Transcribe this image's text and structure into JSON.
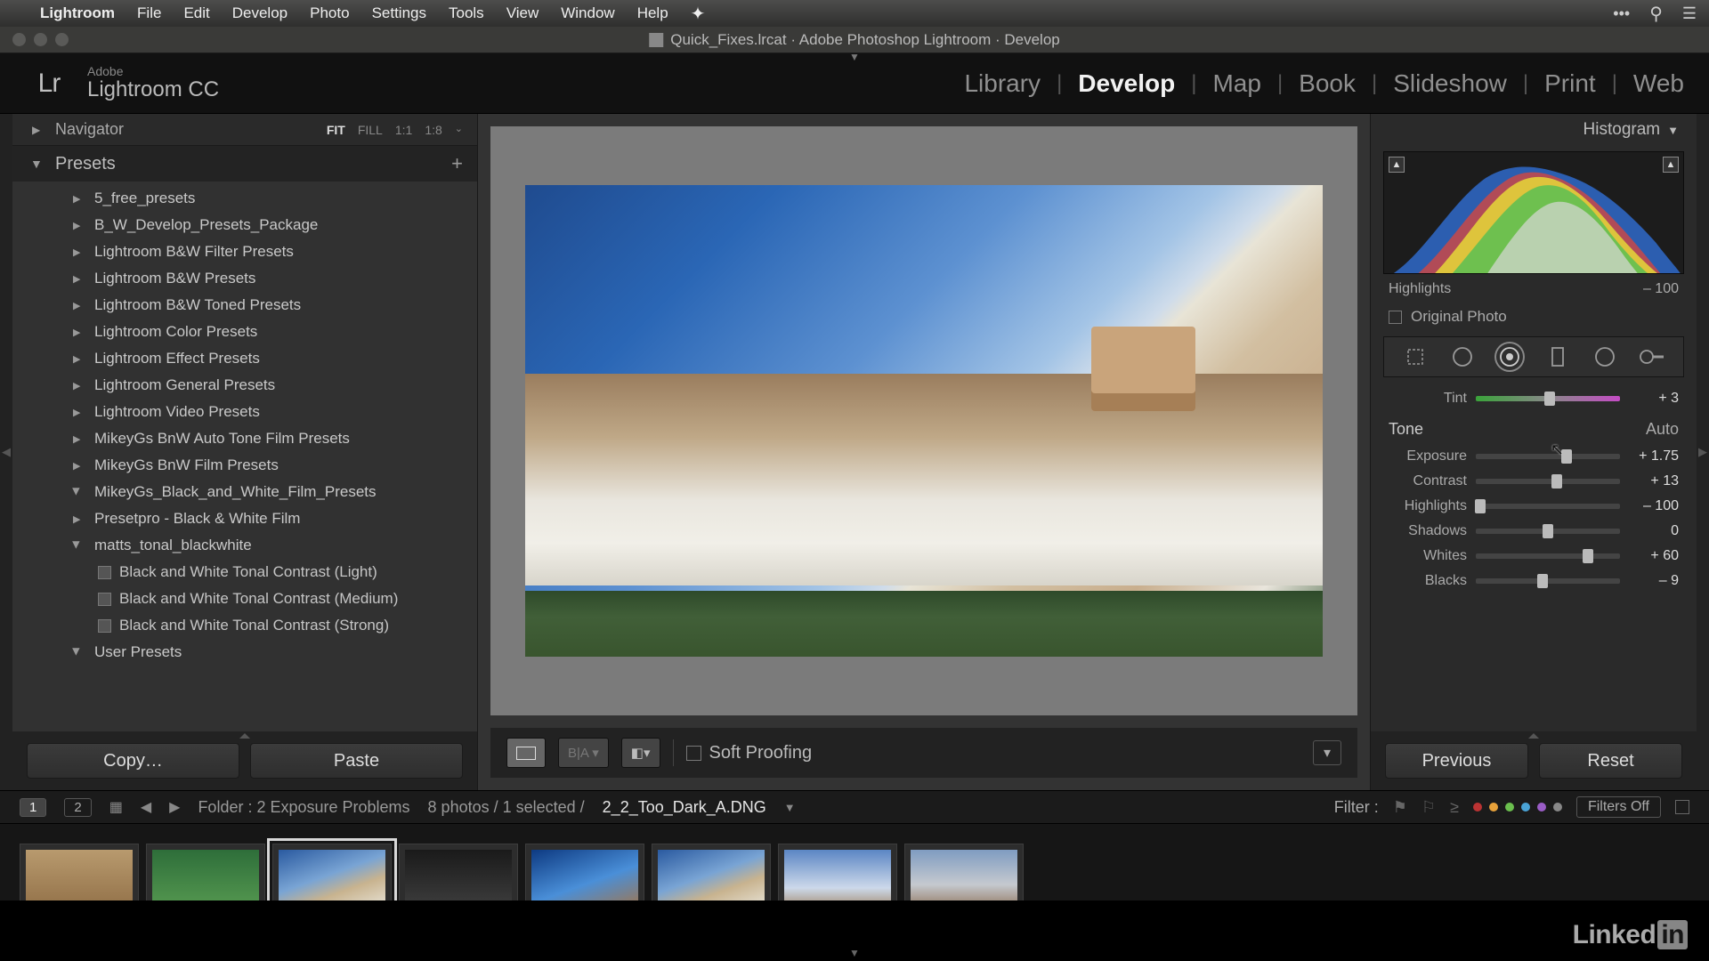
{
  "menubar": {
    "app": "Lightroom",
    "items": [
      "File",
      "Edit",
      "Develop",
      "Photo",
      "Settings",
      "Tools",
      "View",
      "Window",
      "Help"
    ]
  },
  "window": {
    "title": "Quick_Fixes.lrcat · Adobe Photoshop Lightroom · Develop"
  },
  "identity": {
    "brand_small": "Adobe",
    "brand_large": "Lightroom CC",
    "logo": "Lr"
  },
  "modules": [
    "Library",
    "Develop",
    "Map",
    "Book",
    "Slideshow",
    "Print",
    "Web"
  ],
  "modules_active": "Develop",
  "nav": {
    "title": "Navigator",
    "opts": [
      "FIT",
      "FILL",
      "1:1",
      "1:8"
    ],
    "active": "FIT"
  },
  "presets": {
    "title": "Presets",
    "folders": [
      {
        "name": "5_free_presets",
        "open": false
      },
      {
        "name": "B_W_Develop_Presets_Package",
        "open": false
      },
      {
        "name": "Lightroom B&W Filter Presets",
        "open": false
      },
      {
        "name": "Lightroom B&W Presets",
        "open": false
      },
      {
        "name": "Lightroom B&W Toned Presets",
        "open": false
      },
      {
        "name": "Lightroom Color Presets",
        "open": false
      },
      {
        "name": "Lightroom Effect Presets",
        "open": false
      },
      {
        "name": "Lightroom General Presets",
        "open": false
      },
      {
        "name": "Lightroom Video Presets",
        "open": false
      },
      {
        "name": "MikeyGs BnW Auto Tone Film Presets",
        "open": false
      },
      {
        "name": "MikeyGs BnW Film Presets",
        "open": false
      },
      {
        "name": "MikeyGs_Black_and_White_Film_Presets",
        "open": true,
        "items": []
      },
      {
        "name": "Presetpro - Black & White Film",
        "open": false
      },
      {
        "name": "matts_tonal_blackwhite",
        "open": true,
        "items": [
          "Black and White Tonal Contrast (Light)",
          "Black and White Tonal Contrast (Medium)",
          "Black and White Tonal Contrast (Strong)"
        ]
      },
      {
        "name": "User Presets",
        "open": true,
        "items": []
      }
    ]
  },
  "buttons": {
    "copy": "Copy…",
    "paste": "Paste",
    "prev": "Previous",
    "reset": "Reset"
  },
  "toolbar": {
    "soft": "Soft Proofing"
  },
  "hist": {
    "title": "Histogram",
    "readout_label": "Highlights",
    "readout_val": "– 100",
    "orig": "Original Photo"
  },
  "wb": {
    "tint_label": "Tint",
    "tint_val": "+ 3"
  },
  "tone": {
    "title": "Tone",
    "auto": "Auto",
    "rows": [
      {
        "label": "Exposure",
        "val": "+ 1.75",
        "pos": 63
      },
      {
        "label": "Contrast",
        "val": "+ 13",
        "pos": 56
      },
      {
        "label": "Highlights",
        "val": "– 100",
        "pos": 3
      },
      {
        "label": "Shadows",
        "val": "0",
        "pos": 50
      },
      {
        "label": "Whites",
        "val": "+ 60",
        "pos": 78
      },
      {
        "label": "Blacks",
        "val": "– 9",
        "pos": 46
      }
    ]
  },
  "status": {
    "folder": "Folder : 2 Exposure Problems",
    "count": "8 photos / 1 selected /",
    "file": "2_2_Too_Dark_A.DNG",
    "filter": "Filter :",
    "filters_off": "Filters Off"
  },
  "filmstrip": {
    "count": 8,
    "selected": 2
  },
  "rating_colors": [
    "#b33",
    "#e8a23a",
    "#6bbf4e",
    "#4aa3d6",
    "#9a5dc6",
    "#888"
  ],
  "brand": "Linked"
}
